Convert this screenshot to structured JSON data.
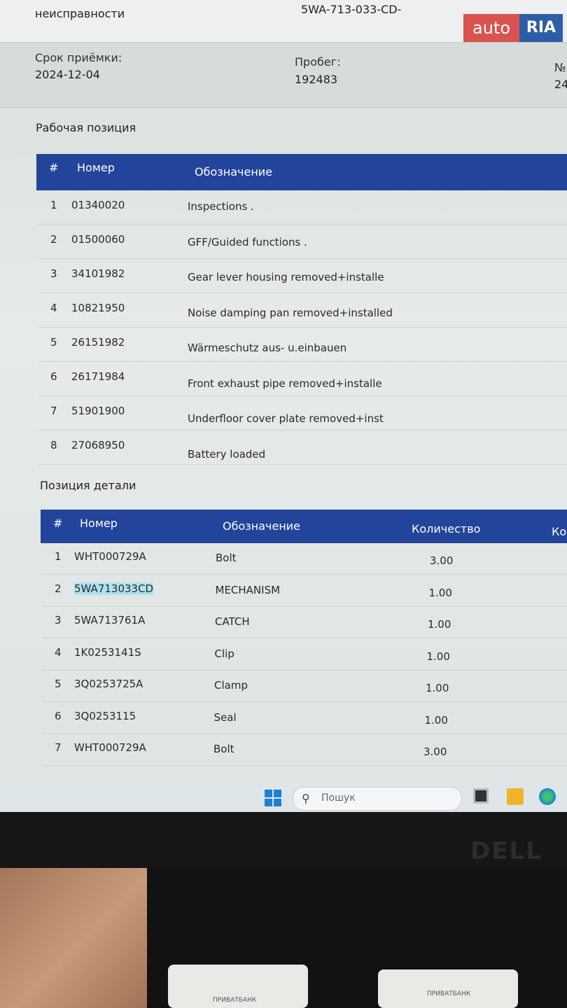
{
  "top": {
    "partial_label": "неисправности",
    "partial_code": "5WA-713-033-CD-"
  },
  "logo": {
    "auto": "auto",
    "ria": "RIA"
  },
  "info": {
    "date_label": "Срок приёмки:",
    "date_value": "2024-12-04",
    "mileage_label": "Пробег:",
    "mileage_value": "192483",
    "no_label": "№",
    "no_value": "24"
  },
  "work": {
    "section_title": "Рабочая позиция",
    "headers": {
      "num": "#",
      "number": "Номер",
      "designation": "Обозначение"
    },
    "rows": [
      {
        "n": "1",
        "code": "01340020",
        "desc": "Inspections ."
      },
      {
        "n": "2",
        "code": "01500060",
        "desc": "GFF/Guided functions ."
      },
      {
        "n": "3",
        "code": "34101982",
        "desc": "Gear lever housing removed+installe"
      },
      {
        "n": "4",
        "code": "10821950",
        "desc": "Noise damping pan removed+installed"
      },
      {
        "n": "5",
        "code": "26151982",
        "desc": "Wärmeschutz aus- u.einbauen"
      },
      {
        "n": "6",
        "code": "26171984",
        "desc": "Front exhaust pipe removed+installe"
      },
      {
        "n": "7",
        "code": "51901900",
        "desc": "Underfloor cover plate removed+inst"
      },
      {
        "n": "8",
        "code": "27068950",
        "desc": "Battery loaded"
      }
    ]
  },
  "parts": {
    "section_title": "Позиция детали",
    "headers": {
      "num": "#",
      "number": "Номер",
      "designation": "Обозначение",
      "qty": "Количество",
      "code": "Ко"
    },
    "rows": [
      {
        "n": "1",
        "code": "WHT000729A",
        "desc": "Bolt",
        "qty": "3.00"
      },
      {
        "n": "2",
        "code": "5WA713033CD",
        "desc": "MECHANISM",
        "qty": "1.00"
      },
      {
        "n": "3",
        "code": "5WA713761A",
        "desc": "CATCH",
        "qty": "1.00"
      },
      {
        "n": "4",
        "code": "1K0253141S",
        "desc": "Clip",
        "qty": "1.00"
      },
      {
        "n": "5",
        "code": "3Q0253725A",
        "desc": "Clamp",
        "qty": "1.00"
      },
      {
        "n": "6",
        "code": "3Q0253115",
        "desc": "Seal",
        "qty": "1.00"
      },
      {
        "n": "7",
        "code": "WHT000729A",
        "desc": "Bolt",
        "qty": "3.00"
      }
    ]
  },
  "taskbar": {
    "search_placeholder": "Пошук"
  },
  "monitor": {
    "brand": "DELL"
  },
  "receipts": {
    "left_text": "ПРИВАТБАНК",
    "right_text": "ПРИВАТБАНК"
  },
  "colors": {
    "header_blue": "#22449a",
    "highlight": "#aee3f0",
    "auto_red": "#d9534f",
    "ria_blue": "#2e5da8"
  }
}
